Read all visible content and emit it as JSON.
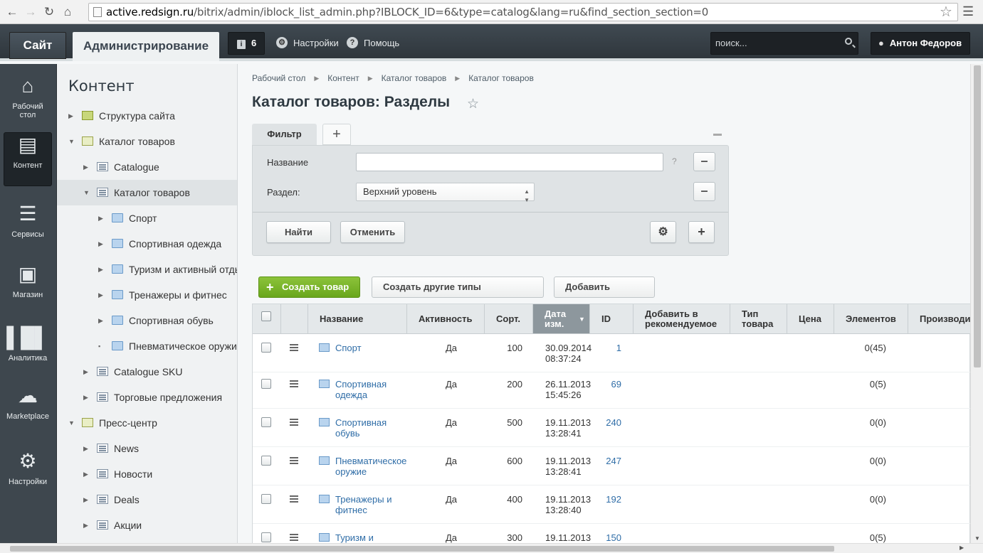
{
  "browser": {
    "url_domain": "active.redsign.ru",
    "url_path": "/bitrix/admin/iblock_list_admin.php?IBLOCK_ID=6&type=catalog&lang=ru&find_section_section=0"
  },
  "topbar": {
    "site_tab": "Сайт",
    "admin_tab": "Администрирование",
    "notifications_count": "6",
    "settings_label": "Настройки",
    "help_label": "Помощь",
    "search_placeholder": "поиск...",
    "user_name": "Антон Федоров"
  },
  "leftpanel": {
    "items": [
      {
        "label": "Рабочий стол",
        "icon": "home-icon"
      },
      {
        "label": "Контент",
        "icon": "document-icon",
        "active": true
      },
      {
        "label": "Сервисы",
        "icon": "layers-icon"
      },
      {
        "label": "Магазин",
        "icon": "basket-icon"
      },
      {
        "label": "Аналитика",
        "icon": "bar-chart-icon"
      },
      {
        "label": "Marketplace",
        "icon": "cloud-download-icon"
      },
      {
        "label": "Настройки",
        "icon": "gear-icon"
      }
    ]
  },
  "tree": {
    "title": "Контент",
    "items": [
      {
        "label": "Структура сайта",
        "level": 0,
        "expanded": false,
        "icon": "structure-icon"
      },
      {
        "label": "Каталог товаров",
        "level": 0,
        "expanded": true,
        "icon": "iblock-icon"
      },
      {
        "label": "Catalogue",
        "level": 1,
        "expanded": false,
        "icon": "list-icon"
      },
      {
        "label": "Каталог товаров",
        "level": 1,
        "expanded": true,
        "icon": "list-icon",
        "selected": true
      },
      {
        "label": "Спорт",
        "level": 2,
        "expanded": false,
        "icon": "folder-icon"
      },
      {
        "label": "Спортивная одежда",
        "level": 2,
        "expanded": false,
        "icon": "folder-icon"
      },
      {
        "label": "Туризм и активный отдых",
        "level": 2,
        "expanded": false,
        "icon": "folder-icon"
      },
      {
        "label": "Тренажеры и фитнес",
        "level": 2,
        "expanded": false,
        "icon": "folder-icon"
      },
      {
        "label": "Спортивная обувь",
        "level": 2,
        "expanded": false,
        "icon": "folder-icon"
      },
      {
        "label": "Пневматическое оружие",
        "level": 2,
        "leaf": true,
        "icon": "folder-icon"
      },
      {
        "label": "Catalogue SKU",
        "level": 1,
        "expanded": false,
        "icon": "list-icon"
      },
      {
        "label": "Торговые предложения",
        "level": 1,
        "expanded": false,
        "icon": "list-icon"
      },
      {
        "label": "Пресс-центр",
        "level": 0,
        "expanded": true,
        "icon": "iblock-icon"
      },
      {
        "label": "News",
        "level": 1,
        "expanded": false,
        "icon": "list-icon"
      },
      {
        "label": "Новости",
        "level": 1,
        "expanded": false,
        "icon": "list-icon"
      },
      {
        "label": "Deals",
        "level": 1,
        "expanded": false,
        "icon": "list-icon"
      },
      {
        "label": "Акции",
        "level": 1,
        "expanded": false,
        "icon": "list-icon"
      }
    ]
  },
  "main": {
    "breadcrumb": [
      "Рабочий стол",
      "Контент",
      "Каталог товаров",
      "Каталог товаров"
    ],
    "title": "Каталог товаров: Разделы",
    "filter": {
      "tab_label": "Фильтр",
      "add_tab": "+",
      "name_label": "Название",
      "name_value": "",
      "help": "?",
      "section_label": "Раздел:",
      "section_value": "Верхний уровень",
      "find_button": "Найти",
      "cancel_button": "Отменить"
    },
    "actions": {
      "create_button": "Создать товар",
      "create_other_button": "Создать другие типы товаров",
      "add_section_button": "Добавить раздел"
    },
    "table": {
      "headers": [
        "Название",
        "Активность",
        "Сорт.",
        "Дата изм.",
        "ID",
        "Добавить в рекомендуемое",
        "Тип товара",
        "Цена",
        "Элементов",
        "Производи"
      ],
      "rows": [
        {
          "name": "Спорт",
          "active": "Да",
          "sort": "100",
          "date": "30.09.2014",
          "time": "08:37:24",
          "id": "1",
          "elements": "0(45)"
        },
        {
          "name": "Спортивная одежда",
          "active": "Да",
          "sort": "200",
          "date": "26.11.2013",
          "time": "15:45:26",
          "id": "69",
          "elements": "0(5)"
        },
        {
          "name": "Спортивная обувь",
          "active": "Да",
          "sort": "500",
          "date": "19.11.2013",
          "time": "13:28:41",
          "id": "240",
          "elements": "0(0)"
        },
        {
          "name": "Пневматическое оружие",
          "active": "Да",
          "sort": "600",
          "date": "19.11.2013",
          "time": "13:28:41",
          "id": "247",
          "elements": "0(0)"
        },
        {
          "name": "Тренажеры и фитнес",
          "active": "Да",
          "sort": "400",
          "date": "19.11.2013",
          "time": "13:28:40",
          "id": "192",
          "elements": "0(0)"
        },
        {
          "name": "Туризм и",
          "active": "Да",
          "sort": "300",
          "date": "19.11.2013",
          "time": "",
          "id": "150",
          "elements": "0(5)"
        }
      ]
    }
  },
  "colors": {
    "accent_green": "#76b32a",
    "link_blue": "#2f6da7",
    "topbar_dark": "#353d43"
  }
}
